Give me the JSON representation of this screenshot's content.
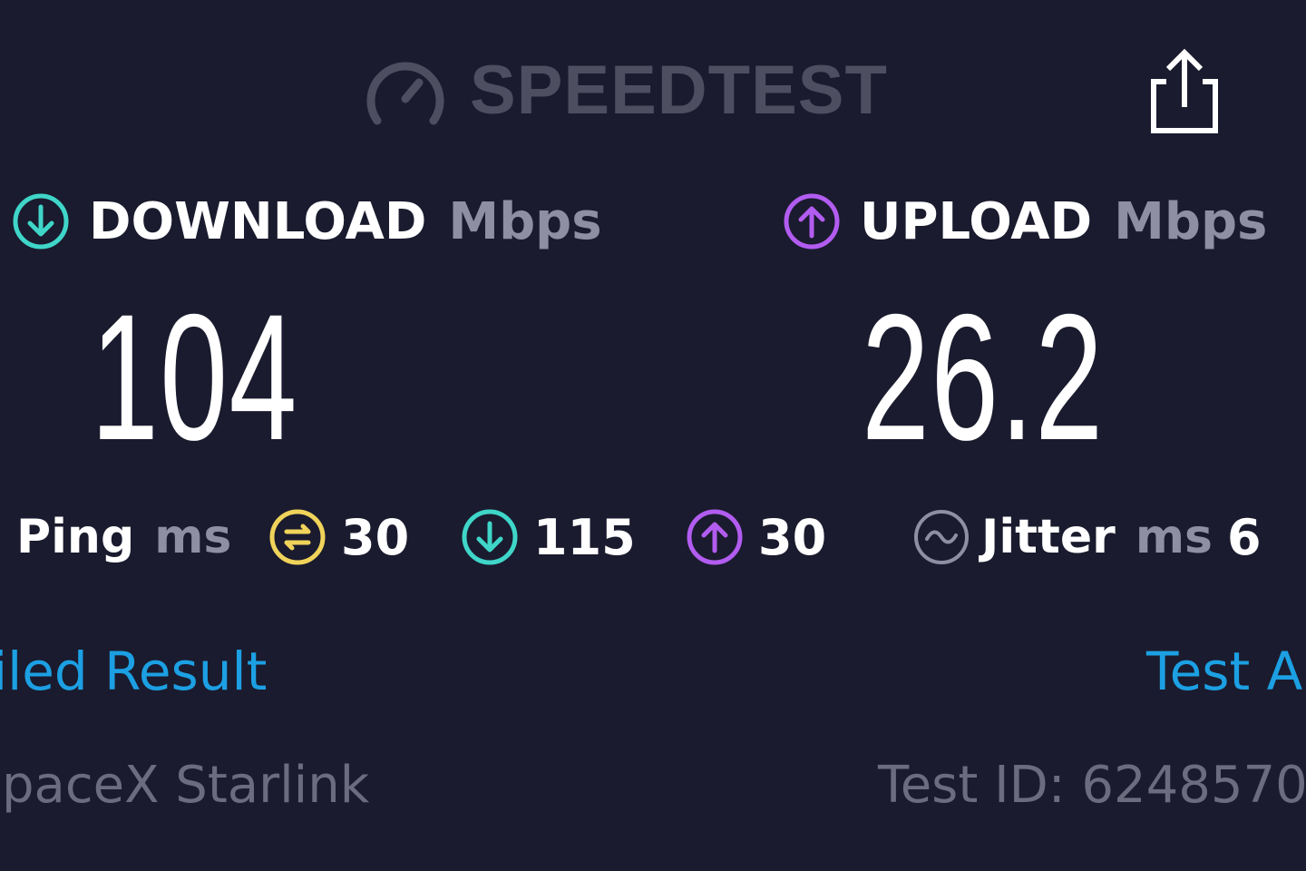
{
  "header": {
    "brand_name": "SPEEDTEST",
    "brand_icon": "speedometer-icon",
    "share_icon": "share-icon"
  },
  "download": {
    "label": "DOWNLOAD",
    "unit": "Mbps",
    "value": "104",
    "icon": "download-arrow-icon",
    "color": "#3fd6c9"
  },
  "upload": {
    "label": "UPLOAD",
    "unit": "Mbps",
    "value": "26.2",
    "icon": "upload-arrow-icon",
    "color": "#b25cf0"
  },
  "ping": {
    "label": "Ping",
    "unit": "ms",
    "idle": {
      "value": "30",
      "icon": "idle-ping-icon",
      "color": "#f0d35a"
    },
    "download": {
      "value": "115",
      "icon": "download-arrow-icon",
      "color": "#3fd6c9"
    },
    "upload": {
      "value": "30",
      "icon": "upload-arrow-icon",
      "color": "#b25cf0"
    }
  },
  "jitter": {
    "label": "Jitter",
    "unit": "ms",
    "value": "6",
    "icon": "jitter-wave-icon",
    "color": "#8e8fa3"
  },
  "links": {
    "detailed_result": "iled Result",
    "test_again": "Test A"
  },
  "footer": {
    "provider": "paceX Starlink",
    "test_id": "Test ID: 6248570"
  }
}
